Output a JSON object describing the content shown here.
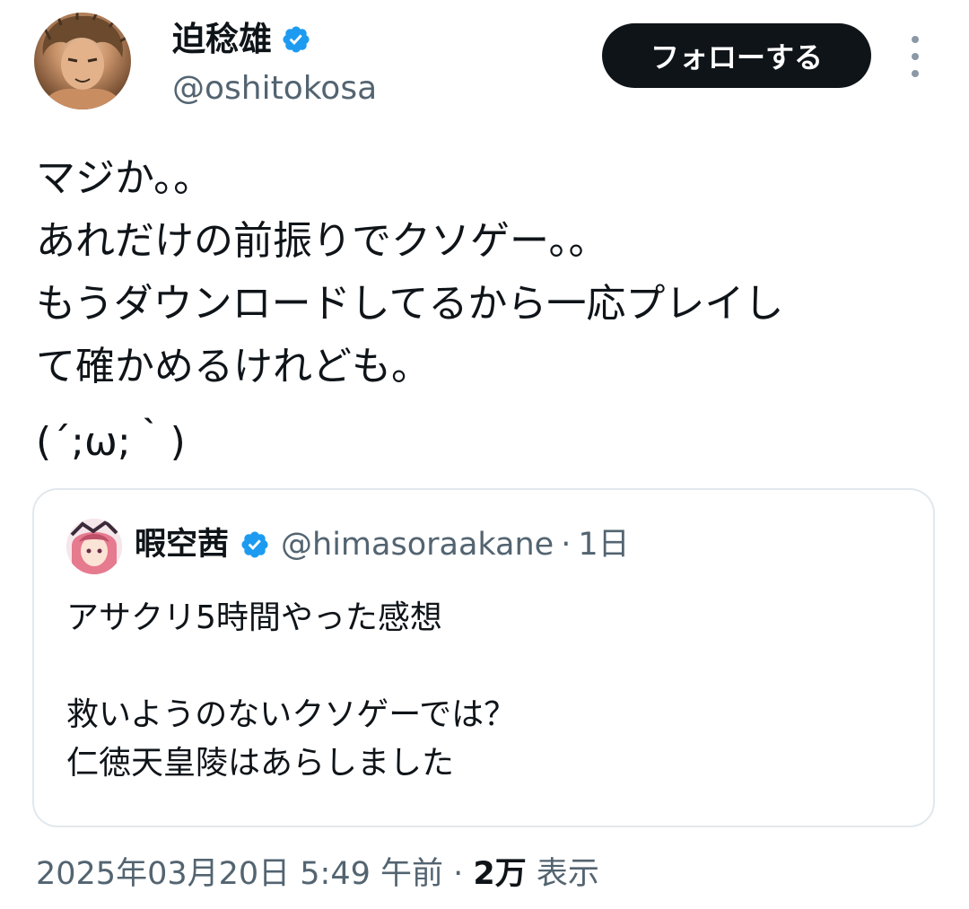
{
  "author": {
    "display_name": "迫稔雄",
    "handle": "@oshitokosa",
    "verified": true
  },
  "follow_button": {
    "label": "フォローする"
  },
  "more_menu": {
    "icon": "more-vertical-icon"
  },
  "tweet": {
    "lines": [
      "マジか。。",
      "あれだけの前振りでクソゲー。。",
      "もうダウンロードしてるから一応プレイし",
      "て確かめるけれども。",
      "(´;ω;｀)"
    ]
  },
  "quote": {
    "display_name": "暇空茜",
    "handle": "@himasoraakane",
    "separator": "·",
    "time": "1日",
    "verified": true,
    "lines": [
      "アサクリ5時間やった感想",
      "",
      "救いようのないクソゲーでは？",
      "仁徳天皇陵はあらしました"
    ]
  },
  "meta": {
    "timestamp": "2025年03月20日 5:49 午前",
    "separator": "·",
    "views_count": "2万",
    "views_label": "表示"
  },
  "colors": {
    "verified_badge": "#1d9bf0",
    "follow_button_bg": "#0f1419",
    "secondary_text": "#536471",
    "card_border": "#e1e8ed"
  }
}
